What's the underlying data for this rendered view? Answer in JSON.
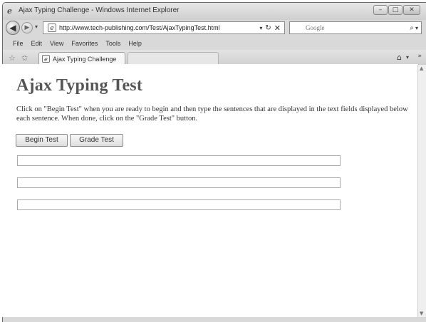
{
  "window": {
    "title": "Ajax Typing Challenge - Windows Internet Explorer",
    "minimize_glyph": "–",
    "maximize_glyph": "□",
    "close_glyph": "✕"
  },
  "address_bar": {
    "url": "http://www.tech-publishing.com/Test/AjaxTypingTest.html",
    "search_placeholder": "Google"
  },
  "menu": {
    "items": [
      "File",
      "Edit",
      "View",
      "Favorites",
      "Tools",
      "Help"
    ]
  },
  "tabs": {
    "active_label": "Ajax Typing Challenge"
  },
  "page": {
    "title": "Ajax Typing Test",
    "instructions": "Click on \"Begin Test\" when you are ready to begin and then type the sentences that are displayed in the text fields displayed below each sentence. When done, click on the \"Grade Test\" button.",
    "begin_button": "Begin Test",
    "grade_button": "Grade Test",
    "fields": [
      "",
      "",
      ""
    ]
  },
  "icons": {
    "ie": "ie-logo-icon",
    "back": "back-arrow-icon",
    "forward": "forward-arrow-icon",
    "refresh": "refresh-icon",
    "stop": "stop-icon",
    "search": "search-icon",
    "favorites": "favorites-star-icon",
    "add_favorites": "add-favorites-icon",
    "home": "home-icon"
  }
}
